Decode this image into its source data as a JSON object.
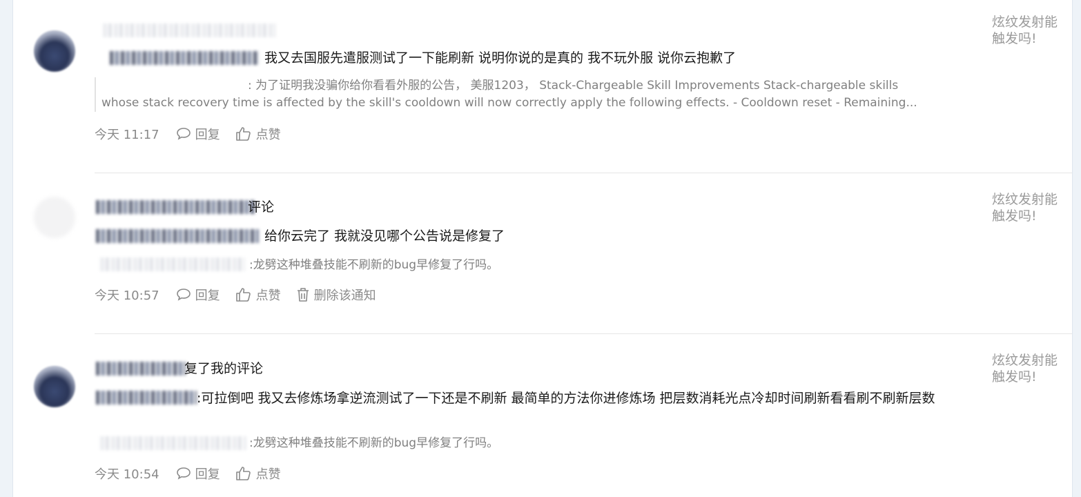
{
  "notifications": [
    {
      "headline": "我又去国服先遣服测试了一下能刷新 说明你说的是真的 我不玩外服 说你云抱歉了",
      "quote_prefix": ": 为了证明我没骗你给你看看外服的公告， 美服1203， Stack-Chargeable Skill Improvements Stack-chargeable skills",
      "quote_line2": "whose stack recovery time is affected by the skill's cooldown will now correctly apply the following effects. - Cooldown reset - Remaining...",
      "time": "今天 11:17",
      "reply_label": "回复",
      "like_label": "点赞",
      "side_note": "炫纹发射能触发吗!"
    },
    {
      "title_suffix": "评论",
      "headline": "给你云完了 我就没见哪个公告说是修复了",
      "quote_prefix": ":龙劈这种堆叠技能不刷新的bug早修复了行吗。",
      "time": "今天 10:57",
      "reply_label": "回复",
      "like_label": "点赞",
      "delete_label": "删除该通知",
      "side_note": "炫纹发射能触发吗!"
    },
    {
      "title_suffix": "复了我的评论",
      "headline": ":可拉倒吧 我又去修炼场拿逆流测试了一下还是不刷新 最简单的方法你进修炼场 把层数消耗光点冷却时间刷新看看刷不刷新层数",
      "quote_prefix": ":龙劈这种堆叠技能不刷新的bug早修复了行吗。",
      "time": "今天 10:54",
      "reply_label": "回复",
      "like_label": "点赞",
      "side_note": "炫纹发射能触发吗!"
    }
  ],
  "icons": {
    "reply": "speech-bubble-icon",
    "like": "thumbs-up-icon",
    "delete": "trash-can-icon"
  },
  "colors": {
    "meta_text": "#8a8a8a",
    "quote_text": "#808080",
    "side_note": "#9a9a9a"
  }
}
